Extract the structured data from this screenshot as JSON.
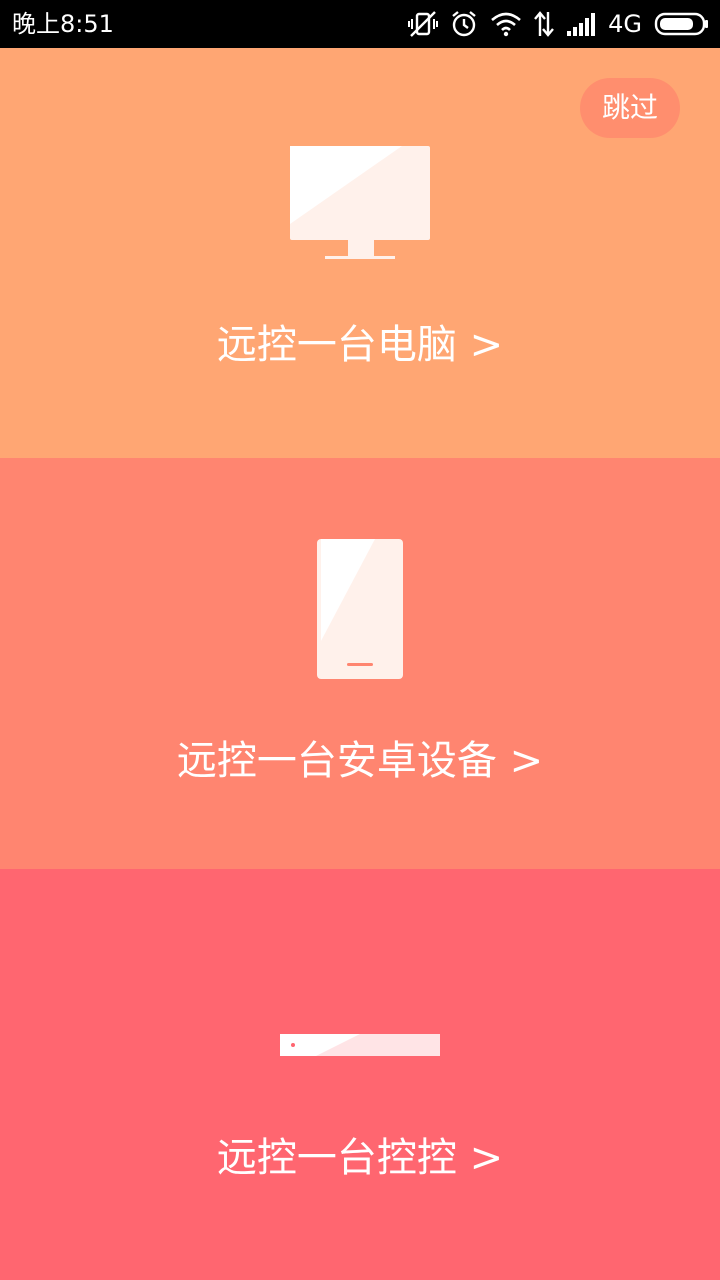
{
  "status_bar": {
    "time": "晚上8:51",
    "network": "4G",
    "icons": [
      "vibrate-off-icon",
      "alarm-icon",
      "wifi-icon",
      "data-transfer-icon",
      "signal-icon",
      "battery-icon"
    ]
  },
  "skip_button": {
    "label": "跳过"
  },
  "options": [
    {
      "label": "远控一台电脑 >",
      "icon": "monitor-icon"
    },
    {
      "label": "远控一台安卓设备 >",
      "icon": "phone-icon"
    },
    {
      "label": "远控一台控控 >",
      "icon": "kongkong-device-icon"
    }
  ],
  "colors": {
    "panel_1": "#FFA673",
    "panel_2": "#FF8570",
    "panel_3": "#FF6670",
    "skip_button_bg": "#FF8E6E"
  }
}
